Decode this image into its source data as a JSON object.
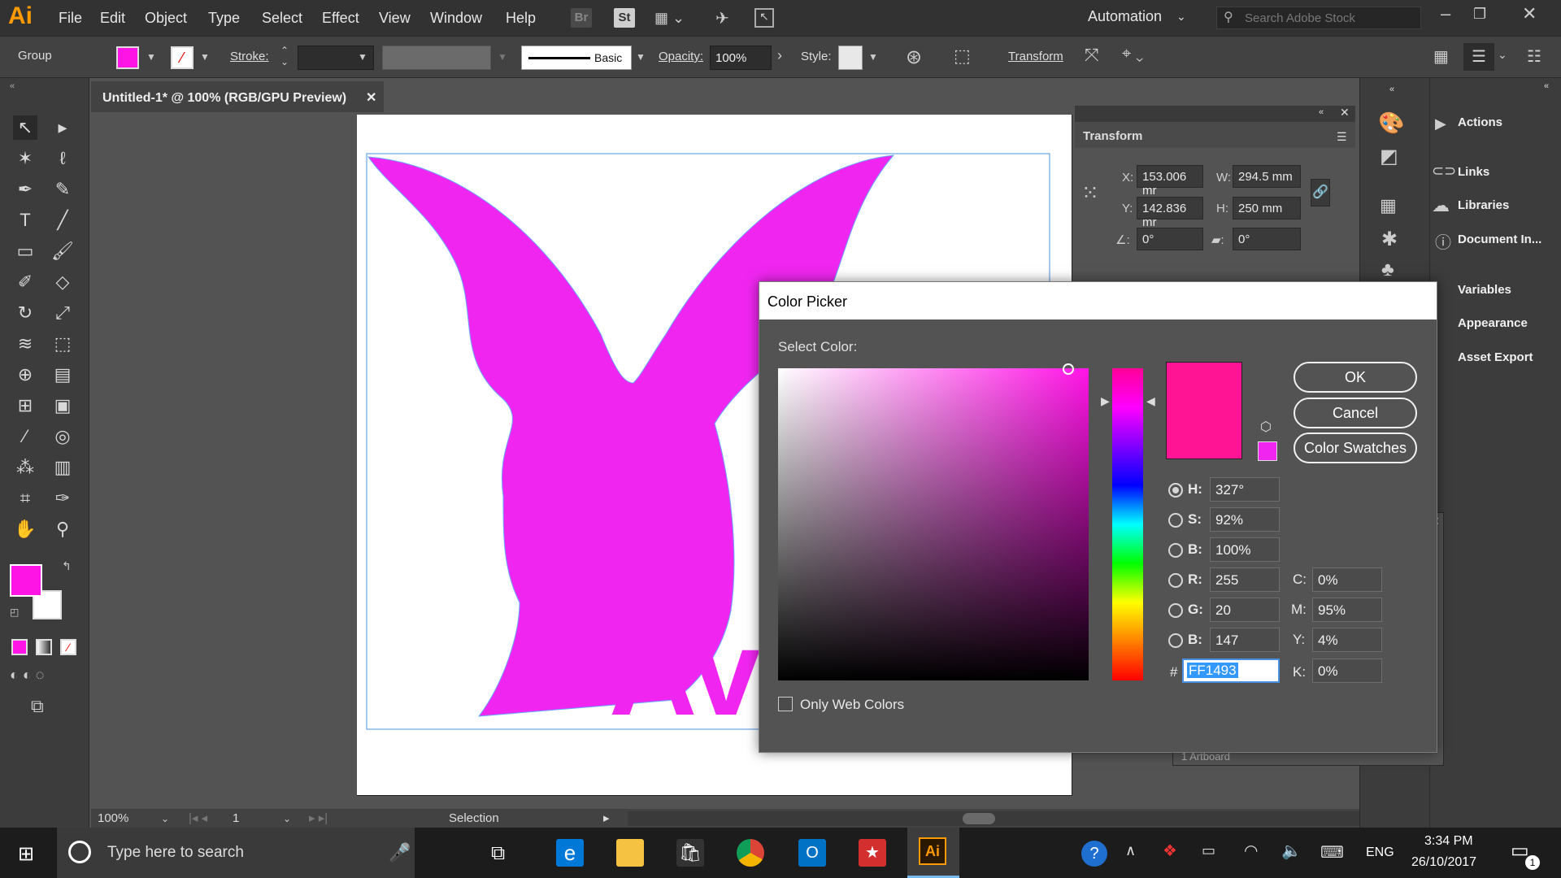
{
  "app": {
    "logo": "Ai",
    "menu": [
      "File",
      "Edit",
      "Object",
      "Type",
      "Select",
      "Effect",
      "View",
      "Window",
      "Help"
    ],
    "bridge_chip": "Br",
    "stock_chip": "St",
    "workspace": "Automation",
    "search_placeholder": "Search Adobe Stock"
  },
  "control_bar": {
    "selection_type": "Group",
    "stroke_label": "Stroke:",
    "brush_label": "Basic",
    "opacity_label": "Opacity:",
    "opacity_value": "100%",
    "style_label": "Style:",
    "transform_link": "Transform",
    "fill_color": "#ff14e6"
  },
  "document": {
    "tab_title": "Untitled-1* @ 100% (RGB/GPU Preview)",
    "artwork_text": "Ava",
    "artwork_color": "#f026f0"
  },
  "transform_panel": {
    "title": "Transform",
    "x_label": "X:",
    "x_value": "153.006 mr",
    "y_label": "Y:",
    "y_value": "142.836 mr",
    "w_label": "W:",
    "w_value": "294.5 mm",
    "h_label": "H:",
    "h_value": "250 mm",
    "angle_value": "0°",
    "shear_value": "0°"
  },
  "right_panel": {
    "items": [
      "Actions",
      "Links",
      "Libraries",
      "Document In...",
      "Variables",
      "Appearance",
      "Asset Export"
    ],
    "artboards_label": "1 Artboard"
  },
  "status_bar": {
    "zoom": "100%",
    "artboard_number": "1",
    "tool_status": "Selection"
  },
  "color_picker": {
    "title": "Color Picker",
    "select_label": "Select Color:",
    "ok": "OK",
    "cancel": "Cancel",
    "swatches": "Color Swatches",
    "new_color": "#ff1493",
    "old_color": "#f026f0",
    "h_label": "H:",
    "h_value": "327°",
    "s_label": "S:",
    "s_value": "92%",
    "b_label": "B:",
    "b_value": "100%",
    "r_label": "R:",
    "r_value": "255",
    "g_label": "G:",
    "g_value": "20",
    "b2_label": "B:",
    "b2_value": "147",
    "c_label": "C:",
    "c_value": "0%",
    "m_label": "M:",
    "m_value": "95%",
    "y_label": "Y:",
    "y_value": "4%",
    "k_label": "K:",
    "k_value": "0%",
    "hex_label": "#",
    "hex_value": "FF1493",
    "web_colors_label": "Only Web Colors"
  },
  "taskbar": {
    "search_placeholder": "Type here to search",
    "language": "ENG",
    "time": "3:34 PM",
    "date": "26/10/2017",
    "notifications": "1"
  }
}
